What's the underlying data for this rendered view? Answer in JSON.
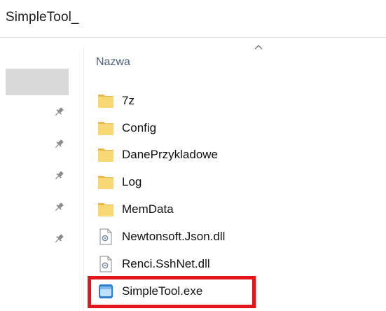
{
  "window": {
    "title": "SimpleTool_"
  },
  "nav_pane": {
    "pins": [
      "pin-icon",
      "pin-icon",
      "pin-icon",
      "pin-icon",
      "pin-icon"
    ]
  },
  "file_list": {
    "column_header": "Nazwa",
    "sort_direction": "ascending",
    "items": [
      {
        "name": "7z",
        "type": "folder",
        "icon": "folder-icon"
      },
      {
        "name": "Config",
        "type": "folder",
        "icon": "folder-icon"
      },
      {
        "name": "DanePrzykladowe",
        "type": "folder",
        "icon": "folder-icon"
      },
      {
        "name": "Log",
        "type": "folder",
        "icon": "folder-icon"
      },
      {
        "name": "MemData",
        "type": "folder",
        "icon": "folder-icon"
      },
      {
        "name": "Newtonsoft.Json.dll",
        "type": "dll",
        "icon": "dll-file-icon"
      },
      {
        "name": "Renci.SshNet.dll",
        "type": "dll",
        "icon": "dll-file-icon"
      },
      {
        "name": "SimpleTool.exe",
        "type": "exe",
        "icon": "exe-app-icon"
      }
    ]
  },
  "colors": {
    "highlight": "#e4161b",
    "folder": "#f8d775",
    "header_text": "#4c607a"
  }
}
